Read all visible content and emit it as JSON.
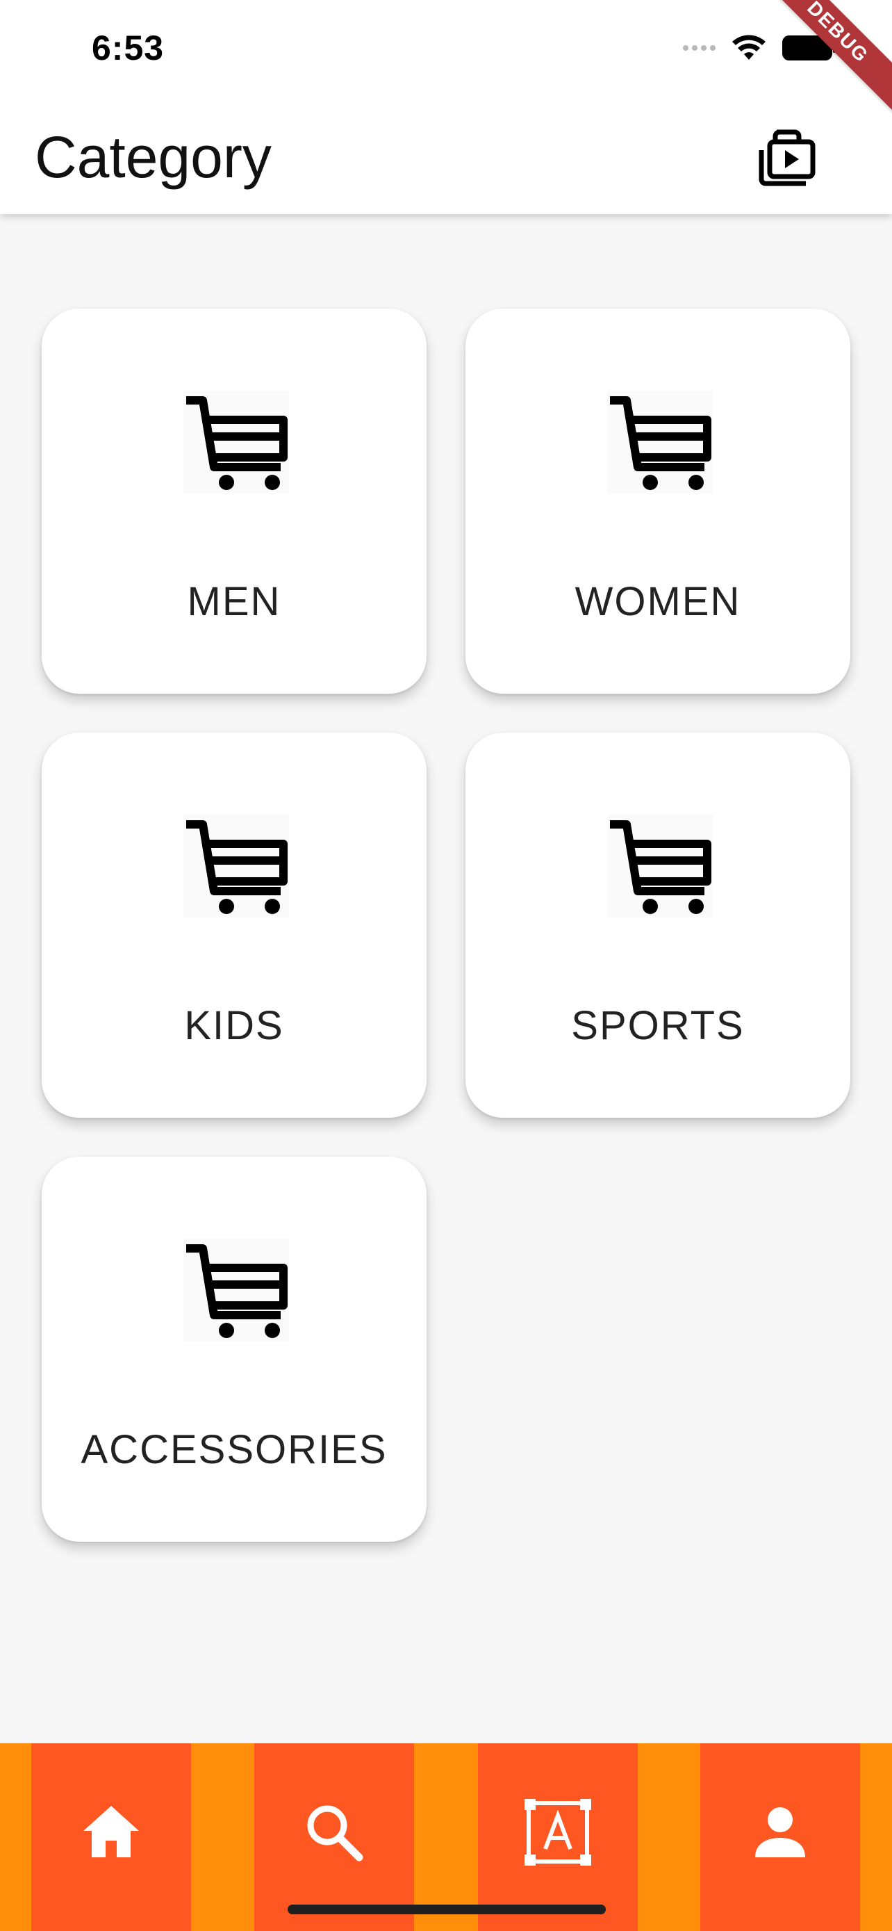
{
  "status_bar": {
    "time": "6:53"
  },
  "debug_banner": "DEBUG",
  "app_bar": {
    "title": "Category",
    "action_icon": "video-library-icon"
  },
  "categories": [
    {
      "label": "MEN",
      "icon": "cart-icon"
    },
    {
      "label": "WOMEN",
      "icon": "cart-icon"
    },
    {
      "label": "KIDS",
      "icon": "cart-icon"
    },
    {
      "label": "SPORTS",
      "icon": "cart-icon"
    },
    {
      "label": "ACCESSORIES",
      "icon": "cart-icon"
    }
  ],
  "bottom_nav": {
    "background_color": "#ff8f0a",
    "tab_color": "#ff5722",
    "tabs": [
      {
        "icon": "home-icon"
      },
      {
        "icon": "search-icon"
      },
      {
        "icon": "text-select-icon"
      },
      {
        "icon": "person-icon"
      }
    ]
  }
}
